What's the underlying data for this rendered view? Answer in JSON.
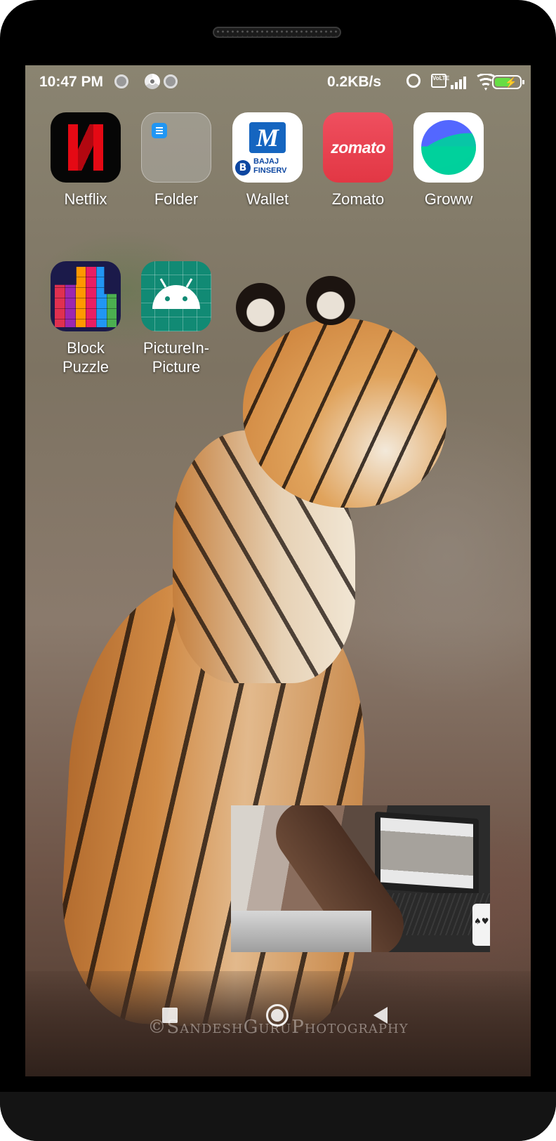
{
  "status_bar": {
    "time": "10:47 PM",
    "network_speed": "0.2KB/s",
    "icons": [
      "notification-dot-icon",
      "chrome-icon",
      "notification-dot-icon",
      "alarm-icon",
      "volte-icon",
      "signal-icon",
      "wifi-icon",
      "battery-charging-icon"
    ],
    "volte_label": "Vo\nLTE",
    "battery_color": "#66dd44"
  },
  "home_screen": {
    "apps": [
      {
        "label": "Netflix",
        "icon": "netflix-icon"
      },
      {
        "label": "Folder",
        "icon": "folder-icon"
      },
      {
        "label": "Wallet",
        "icon": "bajaj-wallet-icon",
        "icon_text": "M",
        "icon_subtext_1": "BAJAJ",
        "icon_subtext_2": "FINSERV",
        "icon_badge": "B"
      },
      {
        "label": "Zomato",
        "icon": "zomato-icon",
        "icon_text": "zomato"
      },
      {
        "label": "Groww",
        "icon": "groww-icon"
      },
      {
        "label": "Block\nPuzzle",
        "label_line1": "Block",
        "label_line2": "Puzzle",
        "icon": "block-puzzle-icon"
      },
      {
        "label": "PictureIn-\nPicture",
        "label_line1": "PictureIn-",
        "label_line2": "Picture",
        "icon": "android-icon"
      }
    ]
  },
  "pip_window": {
    "content": "video-player"
  },
  "wallpaper": {
    "watermark": "©SandeshGuruPhotography"
  },
  "nav_bar": {
    "buttons": [
      "recents-button",
      "home-button",
      "back-button"
    ]
  },
  "colors": {
    "netflix_red": "#e50914",
    "zomato_red": "#e23744",
    "groww_blue": "#5367ff",
    "groww_green": "#00d09c",
    "android_teal": "#118a74",
    "bajaj_blue": "#0d47a1"
  }
}
